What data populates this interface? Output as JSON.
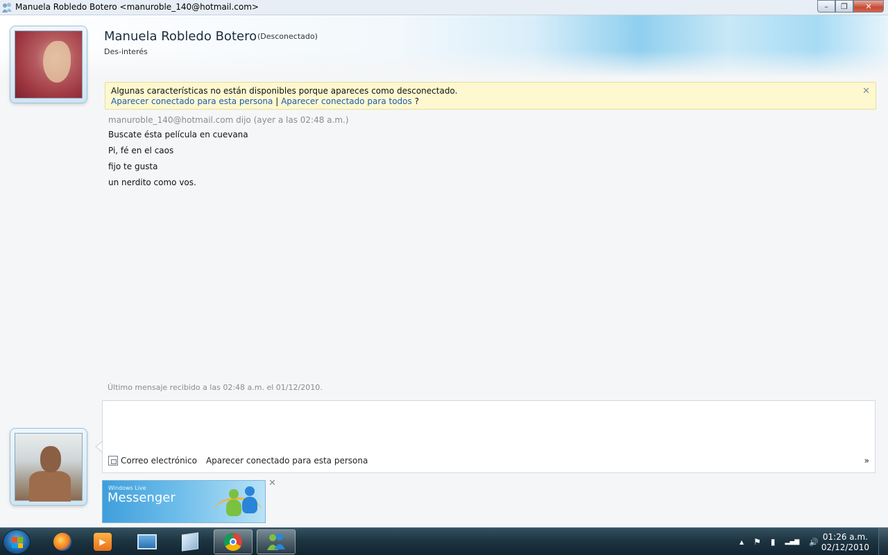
{
  "window": {
    "title": "Manuela Robledo Botero <manuroble_140@hotmail.com>",
    "controls": {
      "minimize": "–",
      "restore": "❐",
      "close": "✕"
    }
  },
  "contact": {
    "name": "Manuela Robledo Botero",
    "status": "(Desconectado)",
    "personal_message": "Des-interés"
  },
  "infobar": {
    "message": "Algunas características no están disponibles porque apareces como desconectado.",
    "link_this_person": "Aparecer conectado para esta persona",
    "separator": "|",
    "link_everyone": "Aparecer conectado para todos",
    "suffix": "?",
    "close": "✕"
  },
  "conversation": {
    "header": "manuroble_140@hotmail.com dijo (ayer a las 02:48 a.m.)",
    "messages": [
      "Buscate ésta película en cuevana",
      "Pi, fé en el caos",
      "fijo te gusta",
      "un nerdito como vos."
    ],
    "last_received": "Último mensaje recibido a las 02:48 a.m. el 01/12/2010."
  },
  "compose": {
    "input_value": "",
    "email_label": "Correo electrónico",
    "appear_online_label": "Aparecer conectado para esta persona",
    "more_label": "»"
  },
  "ad": {
    "brand_small": "Windows Live",
    "brand": "Messenger",
    "close": "✕"
  },
  "taskbar": {
    "apps": [
      "Firefox",
      "Windows Media Player",
      "Remote Desktop",
      "Cube",
      "Google Chrome",
      "Windows Live Messenger"
    ],
    "tray_icons": [
      "▲",
      "⚑",
      "▮",
      "▂▄▆",
      "🔊"
    ],
    "time": "01:26 a.m.",
    "date": "02/12/2010"
  },
  "colors": {
    "link": "#1f5bb3",
    "infobar_bg": "#fdf8cf",
    "taskbar": "#1c3340"
  }
}
